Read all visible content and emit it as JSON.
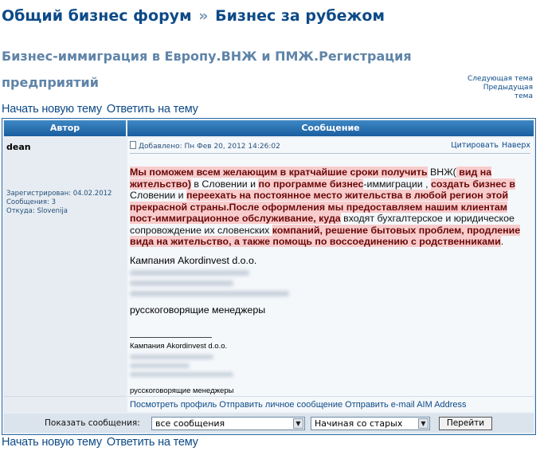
{
  "breadcrumb": {
    "forum": "Общий бизнес форум",
    "separator": "»",
    "section": "Бизнес за рубежом"
  },
  "topic": {
    "title": "Бизнес-иммиграция в Европу.ВНЖ и ПМЖ.Регистрация предприятий",
    "nav": {
      "next": "Следующая тема",
      "prev_line1": "Предыдущая",
      "prev_line2": "тема"
    }
  },
  "actions": {
    "new_topic": "Начать новую тему",
    "reply": "Ответить на тему"
  },
  "table": {
    "col_author": "Автор",
    "col_message": "Сообщение"
  },
  "post": {
    "author": "dean",
    "registered": "Зарегистрирован: 04.02.2012",
    "posts": "Сообщения: 3",
    "location": "Откуда: Slovenija",
    "meta": "Добавлено: Пн Фев 20, 2012 14:26:02",
    "quote": "Цитировать",
    "top": "Наверх",
    "body": {
      "s1": "Мы поможем всем желающим в кратчайшие сроки получить",
      "s2": " ВНЖ(",
      "s3": " вид на жительство)",
      "s4": " в Словении и ",
      "s5": "по программе бизнес",
      "s6": "-иммиграции , ",
      "s7": "создать бизнес в",
      "s8": " Словении и ",
      "s9": "переехать на постоянное место жительства в любой регион этой прекрасной страны.После оформления мы предоставляем нашим клиентам пост-иммиграционное обслуживание, куда",
      "s10": " входят бухгалтерское и юридическое сопровождение их словенских ",
      "s11": "компаний, решение бытовых проблем, продление вида на жительство, а также помощь по воссоединению с родственниками",
      "s12": "."
    },
    "signature": {
      "company": "Кампания Akordinvest d.o.o.",
      "managers": "русскоговорящие менеджеры",
      "company_small": "Кампания Akordinvest d.o.o.",
      "managers_small": "русскоговорящие менеджеры"
    },
    "links": {
      "profile": "Посмотреть профиль",
      "pm": "Отправить личное сообщение",
      "email": "Отправить e-mail",
      "aim": "AIM Address"
    }
  },
  "filter": {
    "label": "Показать сообщения:",
    "option_all": "все сообщения",
    "option_order": "Начиная со старых",
    "go": "Перейти"
  }
}
